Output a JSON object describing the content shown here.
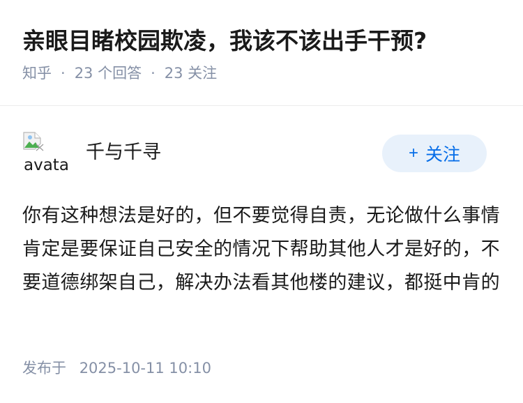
{
  "question": {
    "title": "亲眼目睹校园欺凌，我该不该出手干预?",
    "source": "知乎",
    "answer_count": "23 个回答",
    "follower_count": "23 关注",
    "separator": "·"
  },
  "answer": {
    "author": {
      "name": "千与千寻",
      "avatar_alt": "avatar",
      "avatar_icon": "broken-image-icon"
    },
    "follow_button": {
      "icon": "+",
      "label": "关注"
    },
    "content": "你有这种想法是好的，但不要觉得自责，无论做什么事情肯定是要保证自己安全的情况下帮助其他人才是好的，不要道德绑架自己，解决办法看其他楼的建议，都挺中肯的",
    "publish": {
      "label": "发布于",
      "datetime": "2025-10-11 10:10"
    }
  },
  "colors": {
    "accent": "#056de8",
    "follow_bg": "#e8f1fb",
    "muted_text": "#8590a6",
    "body_text": "#1a1a1a",
    "divider": "#ebebeb"
  }
}
